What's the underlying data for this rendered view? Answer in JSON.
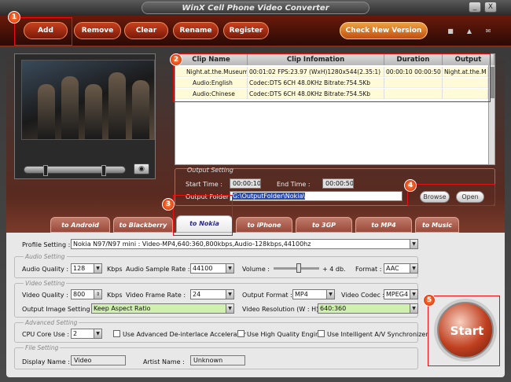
{
  "app": {
    "title": "WinX Cell Phone Video Converter"
  },
  "window_controls": {
    "minimize": "_",
    "close": "X"
  },
  "toolbar": {
    "add": "Add",
    "remove": "Remove",
    "clear": "Clear",
    "rename": "Rename",
    "register": "Register",
    "check_new": "Check New Version",
    "icons": [
      "lock-icon",
      "home-icon",
      "mail-icon"
    ]
  },
  "badges": [
    "1",
    "2",
    "3",
    "4",
    "5"
  ],
  "clip_table": {
    "headers": [
      "Clip Name",
      "Clip Infomation",
      "Duration",
      "Output"
    ],
    "rows": [
      {
        "name": "Night.at.the.Museum",
        "info": "00:01:02   FPS:23.97  (WxH)1280x544(2.35:1)",
        "duration": "00:00:10  00:00:50",
        "output": "Night.at.the.M"
      },
      {
        "name": "Audio:English",
        "info": "Codec:DTS 6CH      48.0KHz   Bitrate:754.5Kb",
        "duration": "",
        "output": ""
      },
      {
        "name": "Audio:Chinese",
        "info": "Codec:DTS 6CH      48.0KHz   Bitrate:754.5Kb",
        "duration": "",
        "output": ""
      }
    ]
  },
  "output_setting": {
    "legend": "Output Setting",
    "start_label": "Start Time :",
    "start_value": "00:00:10",
    "end_label": "End Time :",
    "end_value": "00:00:50",
    "folder_label": "Output Folder :",
    "folder_value": "G:\\OutputFolder\\Nokia\\",
    "browse": "Browse",
    "open": "Open"
  },
  "tabs": [
    "to Android",
    "to Blackberry",
    "to Nokia",
    "to iPhone",
    "to 3GP",
    "to MP4",
    "to Music"
  ],
  "active_tab": "to Nokia",
  "profile": {
    "label": "Profile Setting :",
    "value": "Nokia N97/N97 mini : Video-MP4,640:360,800kbps,Audio-128kbps,44100hz"
  },
  "audio": {
    "legend": "Audio Setting",
    "quality_label": "Audio Quality :",
    "quality_value": "128",
    "quality_unit": "Kbps",
    "rate_label": "Audio Sample Rate :",
    "rate_value": "44100",
    "volume_label": "Volume :",
    "volume_value": "+ 4 db.",
    "volume_level": 0.55,
    "format_label": "Format :",
    "format_value": "AAC"
  },
  "video": {
    "legend": "Video Setting",
    "quality_label": "Video Quality :",
    "quality_value": "800",
    "quality_unit": "Kbps",
    "frame_label": "Video Frame Rate :",
    "frame_value": "24",
    "format_label": "Output Format :",
    "format_value": "MP4",
    "codec_label": "Video Codec :",
    "codec_value": "MPEG4",
    "image_label": "Output Image Setting :",
    "image_value": "Keep Aspect Ratio",
    "res_label": "Video Resolution (W : H) :",
    "res_value": "640:360"
  },
  "advanced": {
    "legend": "Advanced Setting",
    "cpu_label": "CPU Core Use :",
    "cpu_value": "2",
    "deinterlace": "Use Advanced De-interlace Accelerator",
    "hq": "Use High Quality Engine",
    "sync": "Use Intelligent A/V Synchronizer"
  },
  "file": {
    "legend": "File Setting",
    "display_label": "Display Name :",
    "display_value": "Video",
    "artist_label": "Artist Name :",
    "artist_value": "Unknown"
  },
  "start_button": "Start"
}
